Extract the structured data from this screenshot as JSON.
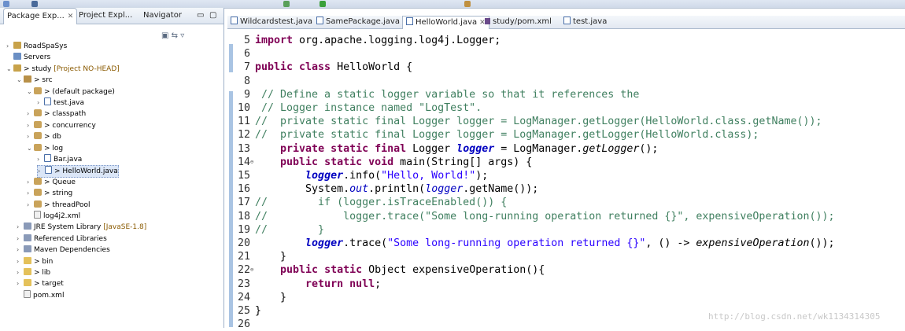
{
  "explorer": {
    "tabs": [
      {
        "label": "Package Exp...",
        "active": true
      },
      {
        "label": "Project Expl...",
        "active": false
      },
      {
        "label": "Navigator",
        "active": false
      }
    ],
    "tree": [
      {
        "indent": 0,
        "twisty": ">",
        "icon": "proj",
        "label": "RoadSpaSys",
        "deco": ""
      },
      {
        "indent": 0,
        "twisty": "",
        "icon": "srv",
        "label": "Servers",
        "deco": ""
      },
      {
        "indent": 0,
        "twisty": "v",
        "icon": "proj",
        "label": "> study",
        "deco": "[Project NO-HEAD]"
      },
      {
        "indent": 1,
        "twisty": "v",
        "icon": "src",
        "label": "> src",
        "deco": ""
      },
      {
        "indent": 2,
        "twisty": "v",
        "icon": "pkg",
        "label": "> (default package)",
        "deco": ""
      },
      {
        "indent": 3,
        "twisty": ">",
        "icon": "java",
        "label": "test.java",
        "deco": ""
      },
      {
        "indent": 2,
        "twisty": ">",
        "icon": "pkg",
        "label": "> classpath",
        "deco": ""
      },
      {
        "indent": 2,
        "twisty": ">",
        "icon": "pkg",
        "label": "> concurrency",
        "deco": ""
      },
      {
        "indent": 2,
        "twisty": ">",
        "icon": "pkg",
        "label": "> db",
        "deco": ""
      },
      {
        "indent": 2,
        "twisty": "v",
        "icon": "pkg",
        "label": "> log",
        "deco": ""
      },
      {
        "indent": 3,
        "twisty": ">",
        "icon": "java",
        "label": "Bar.java",
        "deco": ""
      },
      {
        "indent": 3,
        "twisty": ">",
        "icon": "java",
        "label": "> HelloWorld.java",
        "deco": "",
        "selected": true
      },
      {
        "indent": 2,
        "twisty": ">",
        "icon": "pkg",
        "label": "> Queue",
        "deco": ""
      },
      {
        "indent": 2,
        "twisty": ">",
        "icon": "pkg",
        "label": "> string",
        "deco": ""
      },
      {
        "indent": 2,
        "twisty": ">",
        "icon": "pkg",
        "label": "> threadPool",
        "deco": ""
      },
      {
        "indent": 2,
        "twisty": "",
        "icon": "xml",
        "label": "log4j2.xml",
        "deco": ""
      },
      {
        "indent": 1,
        "twisty": ">",
        "icon": "lib",
        "label": "JRE System Library",
        "deco": "[JavaSE-1.8]"
      },
      {
        "indent": 1,
        "twisty": ">",
        "icon": "lib",
        "label": "Referenced Libraries",
        "deco": ""
      },
      {
        "indent": 1,
        "twisty": ">",
        "icon": "lib",
        "label": "Maven Dependencies",
        "deco": ""
      },
      {
        "indent": 1,
        "twisty": ">",
        "icon": "folder",
        "label": "> bin",
        "deco": ""
      },
      {
        "indent": 1,
        "twisty": ">",
        "icon": "folder",
        "label": "> lib",
        "deco": ""
      },
      {
        "indent": 1,
        "twisty": ">",
        "icon": "folder",
        "label": "> target",
        "deco": ""
      },
      {
        "indent": 1,
        "twisty": "",
        "icon": "xml",
        "label": "pom.xml",
        "deco": ""
      }
    ]
  },
  "editor": {
    "tabs": [
      {
        "label": "Wildcardstest.java",
        "icon": "java",
        "active": false
      },
      {
        "label": "SamePackage.java",
        "icon": "java",
        "active": false
      },
      {
        "label": "HelloWorld.java",
        "icon": "java",
        "active": true
      },
      {
        "label": "study/pom.xml",
        "icon": "maven",
        "active": false
      },
      {
        "label": "test.java",
        "icon": "java",
        "active": false
      }
    ],
    "lines": [
      {
        "n": "5",
        "fold": "",
        "segs": [
          [
            "kw",
            "import"
          ],
          [
            "pl",
            " org.apache.logging.log4j.Logger;"
          ]
        ]
      },
      {
        "n": "6",
        "fold": "",
        "segs": []
      },
      {
        "n": "7",
        "fold": "",
        "segs": [
          [
            "kw",
            "public class"
          ],
          [
            "pl",
            " HelloWorld {"
          ]
        ]
      },
      {
        "n": "8",
        "fold": "",
        "segs": []
      },
      {
        "n": "9",
        "fold": "",
        "segs": [
          [
            "cm",
            " // Define a static logger variable so that it references the"
          ]
        ]
      },
      {
        "n": "10",
        "fold": "",
        "segs": [
          [
            "cm",
            " // Logger instance named \"LogTest\"."
          ]
        ]
      },
      {
        "n": "11",
        "fold": "",
        "segs": [
          [
            "cm",
            "//  private static final Logger logger = LogManager.getLogger(HelloWorld.class.getName());"
          ]
        ]
      },
      {
        "n": "12",
        "fold": "",
        "segs": [
          [
            "cm",
            "//  private static final Logger logger = LogManager.getLogger(HelloWorld.class);"
          ]
        ]
      },
      {
        "n": "13",
        "fold": "",
        "segs": [
          [
            "pl",
            "    "
          ],
          [
            "kw",
            "private static final"
          ],
          [
            "pl",
            " Logger "
          ],
          [
            "fld",
            "logger"
          ],
          [
            "pl",
            " = LogManager."
          ],
          [
            "smeth",
            "getLogger"
          ],
          [
            "pl",
            "();"
          ]
        ]
      },
      {
        "n": "14",
        "fold": "⊖",
        "segs": [
          [
            "pl",
            "    "
          ],
          [
            "kw",
            "public static void"
          ],
          [
            "pl",
            " main(String[] args) {"
          ]
        ]
      },
      {
        "n": "15",
        "fold": "",
        "segs": [
          [
            "pl",
            "        "
          ],
          [
            "fld",
            "logger"
          ],
          [
            "pl",
            ".info("
          ],
          [
            "st",
            "\"Hello, World!\""
          ],
          [
            "pl",
            ");"
          ]
        ]
      },
      {
        "n": "16",
        "fold": "",
        "segs": [
          [
            "pl",
            "        System."
          ],
          [
            "sfld",
            "out"
          ],
          [
            "pl",
            ".println("
          ],
          [
            "sfld",
            "logger"
          ],
          [
            "pl",
            ".getName());"
          ]
        ]
      },
      {
        "n": "17",
        "fold": "",
        "segs": [
          [
            "cm",
            "//        if (logger.isTraceEnabled()) {"
          ]
        ]
      },
      {
        "n": "18",
        "fold": "",
        "segs": [
          [
            "cm",
            "//            logger.trace(\"Some long-running operation returned {}\", expensiveOperation());"
          ]
        ]
      },
      {
        "n": "19",
        "fold": "",
        "segs": [
          [
            "cm",
            "//        }"
          ]
        ]
      },
      {
        "n": "20",
        "fold": "",
        "segs": [
          [
            "pl",
            "        "
          ],
          [
            "fld",
            "logger"
          ],
          [
            "pl",
            ".trace("
          ],
          [
            "st",
            "\"Some long-running operation returned {}\""
          ],
          [
            "pl",
            ", () -> "
          ],
          [
            "smeth",
            "expensiveOperation"
          ],
          [
            "pl",
            "());"
          ]
        ]
      },
      {
        "n": "21",
        "fold": "",
        "segs": [
          [
            "pl",
            "    }"
          ]
        ]
      },
      {
        "n": "22",
        "fold": "⊖",
        "segs": [
          [
            "pl",
            "    "
          ],
          [
            "kw",
            "public static"
          ],
          [
            "pl",
            " Object expensiveOperation(){"
          ]
        ]
      },
      {
        "n": "23",
        "fold": "",
        "segs": [
          [
            "pl",
            "        "
          ],
          [
            "kw",
            "return null"
          ],
          [
            "pl",
            ";"
          ]
        ]
      },
      {
        "n": "24",
        "fold": "",
        "segs": [
          [
            "pl",
            "    }"
          ]
        ]
      },
      {
        "n": "25",
        "fold": "",
        "segs": [
          [
            "pl",
            "}"
          ]
        ]
      },
      {
        "n": "26",
        "fold": "",
        "segs": []
      }
    ]
  },
  "watermark": "http://blog.csdn.net/wk1134314305"
}
